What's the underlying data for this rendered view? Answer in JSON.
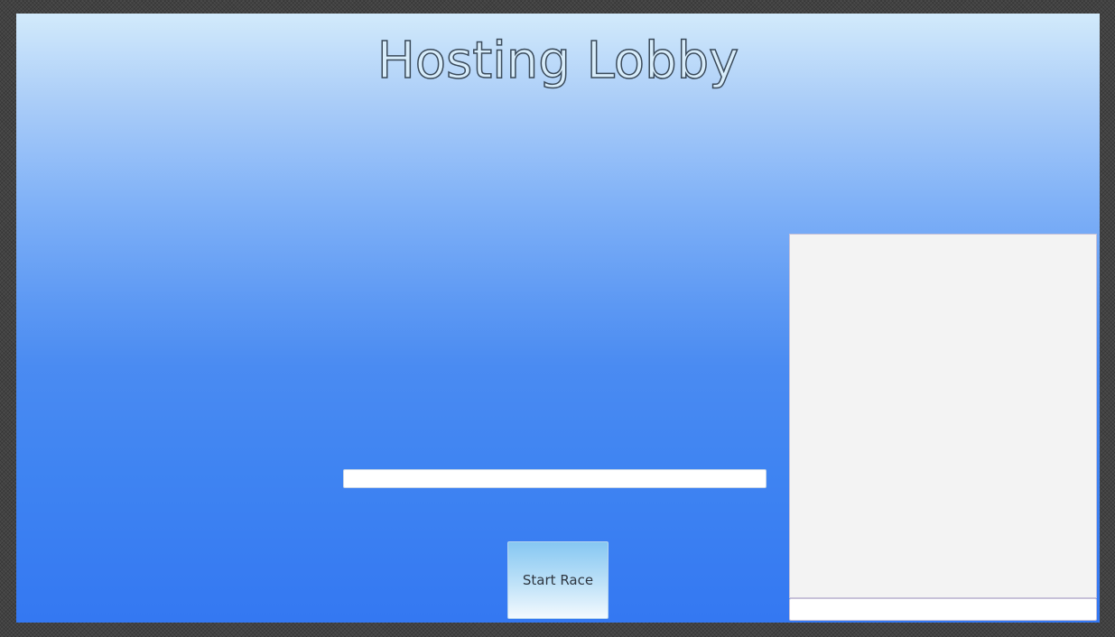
{
  "lobby": {
    "title": "Hosting Lobby",
    "name_field": {
      "value": "",
      "placeholder": ""
    },
    "start_button_label": "Start Race"
  },
  "chat": {
    "messages": [],
    "input": {
      "value": "",
      "placeholder": ""
    }
  },
  "colors": {
    "background_top": "#d2eafb",
    "background_bottom": "#3478f2",
    "button_top": "#86c7f2",
    "button_bottom": "#f3f9fe",
    "chat_panel": "#f3f3f3"
  }
}
